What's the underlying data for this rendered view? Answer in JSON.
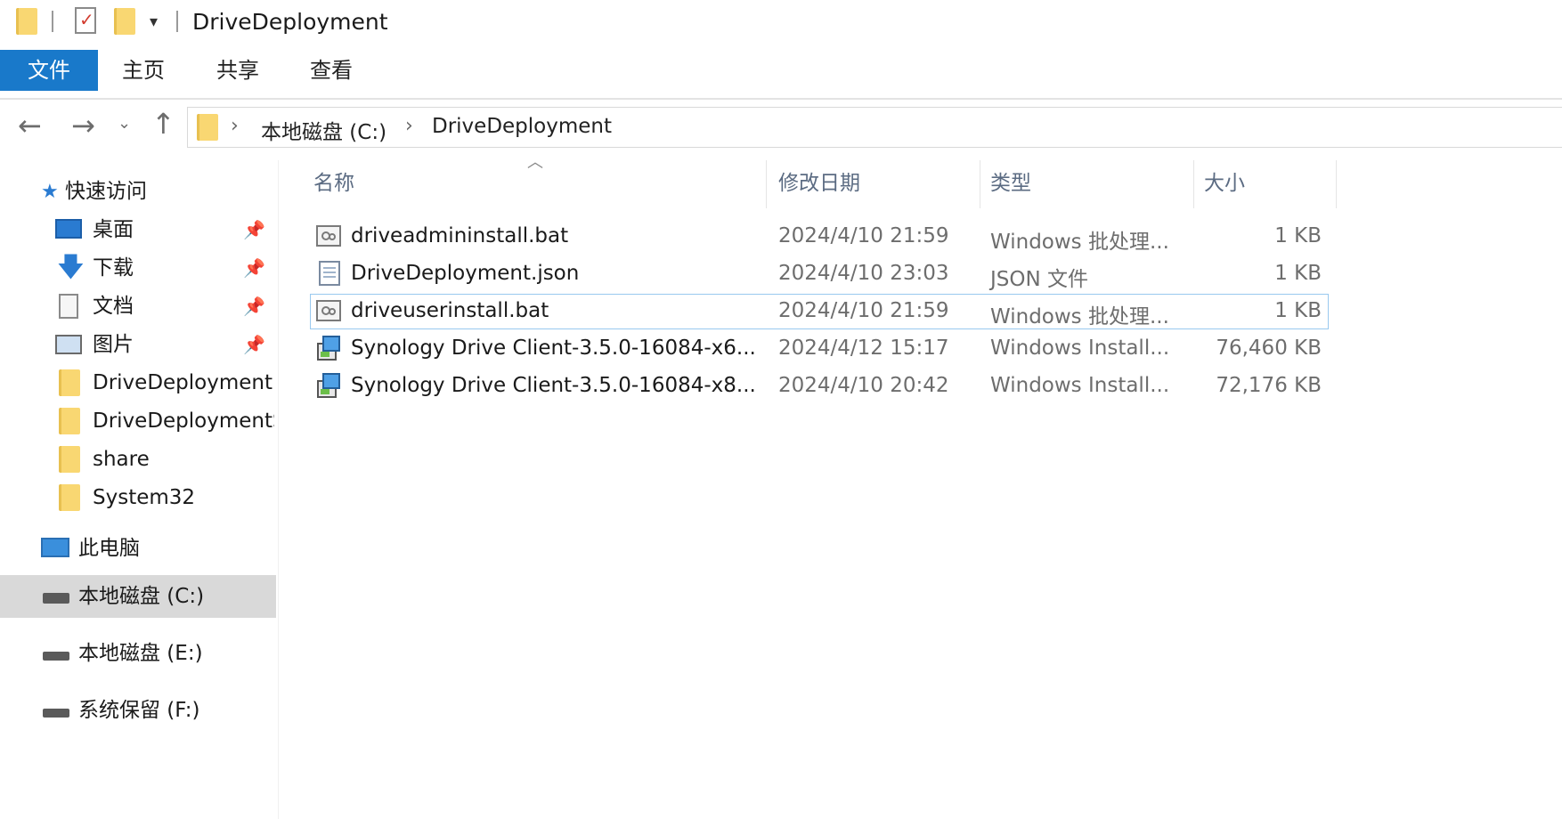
{
  "window": {
    "title": "DriveDeployment"
  },
  "ribbon": {
    "file": "文件",
    "tabs": [
      "主页",
      "共享",
      "查看"
    ]
  },
  "address": {
    "segments": [
      "本地磁盘 (C:)",
      "DriveDeployment"
    ]
  },
  "nav": {
    "quick_access": "快速访问",
    "items": [
      "桌面",
      "下载",
      "文档",
      "图片",
      "DriveDeployment",
      "DriveDeploymentS",
      "share",
      "System32"
    ],
    "this_pc": "此电脑",
    "drives": [
      "本地磁盘 (C:)",
      "本地磁盘 (E:)",
      "系统保留 (F:)"
    ]
  },
  "columns": {
    "name": "名称",
    "date": "修改日期",
    "type": "类型",
    "size": "大小"
  },
  "files": [
    {
      "name": "driveadmininstall.bat",
      "date": "2024/4/10 21:59",
      "type": "Windows 批处理...",
      "size": "1 KB",
      "icon": "batch-file-icon"
    },
    {
      "name": "DriveDeployment.json",
      "date": "2024/4/10 23:03",
      "type": "JSON 文件",
      "size": "1 KB",
      "icon": "json-file-icon"
    },
    {
      "name": "driveuserinstall.bat",
      "date": "2024/4/10 21:59",
      "type": "Windows 批处理...",
      "size": "1 KB",
      "icon": "batch-file-icon"
    },
    {
      "name": "Synology Drive Client-3.5.0-16084-x6...",
      "date": "2024/4/12 15:17",
      "type": "Windows Install...",
      "size": "76,460 KB",
      "icon": "msi-installer-icon"
    },
    {
      "name": "Synology Drive Client-3.5.0-16084-x8...",
      "date": "2024/4/10 20:42",
      "type": "Windows Install...",
      "size": "72,176 KB",
      "icon": "msi-installer-icon"
    }
  ],
  "colors": {
    "accent": "#1979ca",
    "selection_border": "#99c9ef",
    "nav_selected": "#d9d9d9",
    "folder": "#f9d772"
  }
}
